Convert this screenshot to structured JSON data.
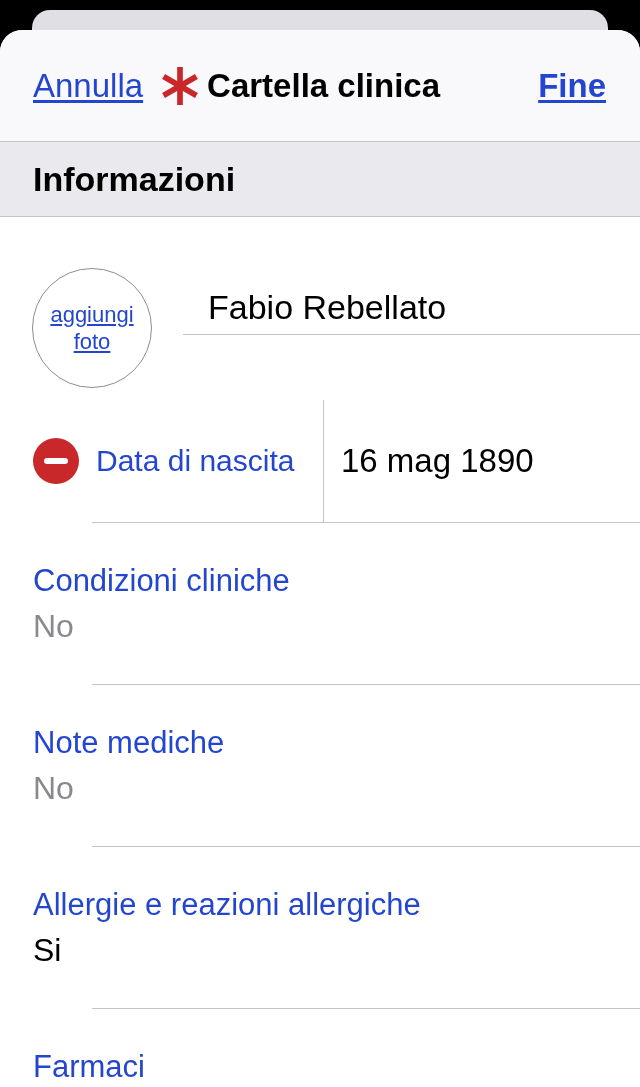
{
  "nav": {
    "cancel": "Annulla",
    "title": "Cartella clinica",
    "done": "Fine"
  },
  "section": {
    "title": "Informazioni"
  },
  "profile": {
    "photo_button": "aggiungi foto",
    "name": "Fabio Rebellato"
  },
  "birth_date": {
    "label": "Data di nascita",
    "value": "16 mag 1890"
  },
  "fields": [
    {
      "label": "Condizioni cliniche",
      "placeholder": "No"
    },
    {
      "label": "Note mediche",
      "placeholder": "No"
    },
    {
      "label": "Allergie e reazioni allergiche",
      "value": "Si"
    },
    {
      "label": "Farmaci"
    }
  ]
}
